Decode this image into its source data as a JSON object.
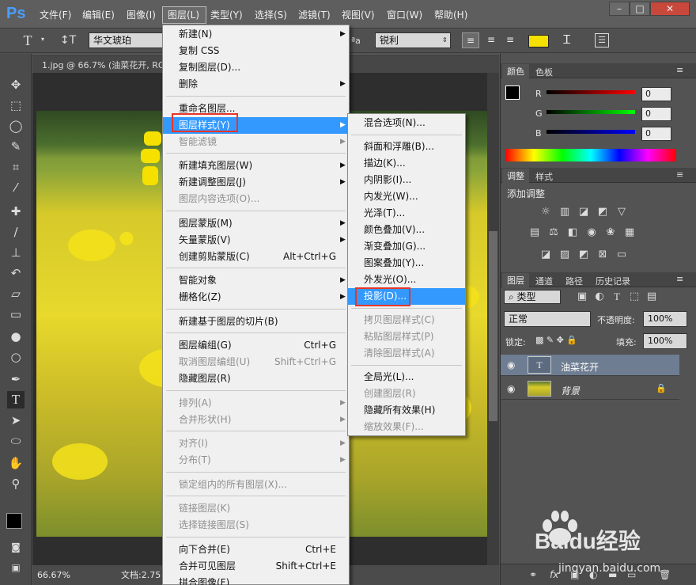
{
  "app": {
    "logo": "Ps",
    "document_tab": "1.jpg @ 66.7% (油菜花开, RGB",
    "zoom": "66.67%",
    "status": "文档:2.75"
  },
  "menubar": {
    "items": [
      "文件(F)",
      "编辑(E)",
      "图像(I)",
      "图层(L)",
      "类型(Y)",
      "选择(S)",
      "滤镜(T)",
      "视图(V)",
      "窗口(W)",
      "帮助(H)"
    ]
  },
  "options": {
    "font": "华文琥珀",
    "antialias": "锐利",
    "color": "#f5e000"
  },
  "layer_menu": {
    "items": [
      {
        "label": "新建(N)",
        "arrow": true
      },
      {
        "label": "复制 CSS"
      },
      {
        "label": "复制图层(D)..."
      },
      {
        "label": "删除",
        "arrow": true
      },
      {
        "sep": true
      },
      {
        "label": "重命名图层..."
      },
      {
        "label": "图层样式(Y)",
        "arrow": true,
        "highlight": true
      },
      {
        "label": "智能滤镜",
        "arrow": true,
        "disabled": true
      },
      {
        "sep": true
      },
      {
        "label": "新建填充图层(W)",
        "arrow": true
      },
      {
        "label": "新建调整图层(J)",
        "arrow": true
      },
      {
        "label": "图层内容选项(O)...",
        "disabled": true
      },
      {
        "sep": true
      },
      {
        "label": "图层蒙版(M)",
        "arrow": true
      },
      {
        "label": "矢量蒙版(V)",
        "arrow": true
      },
      {
        "label": "创建剪贴蒙版(C)",
        "shortcut": "Alt+Ctrl+G"
      },
      {
        "sep": true
      },
      {
        "label": "智能对象",
        "arrow": true
      },
      {
        "label": "栅格化(Z)",
        "arrow": true
      },
      {
        "sep": true
      },
      {
        "label": "新建基于图层的切片(B)"
      },
      {
        "sep": true
      },
      {
        "label": "图层编组(G)",
        "shortcut": "Ctrl+G"
      },
      {
        "label": "取消图层编组(U)",
        "shortcut": "Shift+Ctrl+G",
        "disabled": true
      },
      {
        "label": "隐藏图层(R)"
      },
      {
        "sep": true
      },
      {
        "label": "排列(A)",
        "arrow": true,
        "disabled": true
      },
      {
        "label": "合并形状(H)",
        "arrow": true,
        "disabled": true
      },
      {
        "sep": true
      },
      {
        "label": "对齐(I)",
        "arrow": true,
        "disabled": true
      },
      {
        "label": "分布(T)",
        "arrow": true,
        "disabled": true
      },
      {
        "sep": true
      },
      {
        "label": "锁定组内的所有图层(X)...",
        "disabled": true
      },
      {
        "sep": true
      },
      {
        "label": "链接图层(K)",
        "disabled": true
      },
      {
        "label": "选择链接图层(S)",
        "disabled": true
      },
      {
        "sep": true
      },
      {
        "label": "向下合并(E)",
        "shortcut": "Ctrl+E"
      },
      {
        "label": "合并可见图层",
        "shortcut": "Shift+Ctrl+E"
      },
      {
        "label": "拼合图像(F)"
      }
    ]
  },
  "style_menu": {
    "items": [
      {
        "label": "混合选项(N)..."
      },
      {
        "sep": true
      },
      {
        "label": "斜面和浮雕(B)..."
      },
      {
        "label": "描边(K)..."
      },
      {
        "label": "内阴影(I)..."
      },
      {
        "label": "内发光(W)..."
      },
      {
        "label": "光泽(T)..."
      },
      {
        "label": "颜色叠加(V)..."
      },
      {
        "label": "渐变叠加(G)..."
      },
      {
        "label": "图案叠加(Y)..."
      },
      {
        "label": "外发光(O)..."
      },
      {
        "label": "投影(D)...",
        "highlight": true
      },
      {
        "sep": true
      },
      {
        "label": "拷贝图层样式(C)",
        "disabled": true
      },
      {
        "label": "粘贴图层样式(P)",
        "disabled": true
      },
      {
        "label": "清除图层样式(A)",
        "disabled": true
      },
      {
        "sep": true
      },
      {
        "label": "全局光(L)..."
      },
      {
        "label": "创建图层(R)",
        "disabled": true
      },
      {
        "label": "隐藏所有效果(H)"
      },
      {
        "label": "缩放效果(F)...",
        "disabled": true
      }
    ]
  },
  "color_panel": {
    "tabs": [
      "颜色",
      "色板"
    ],
    "r_label": "R",
    "g_label": "G",
    "b_label": "B",
    "r": "0",
    "g": "0",
    "b": "0"
  },
  "adjust_panel": {
    "tabs": [
      "调整",
      "样式"
    ],
    "title": "添加调整"
  },
  "layers_panel": {
    "tabs": [
      "图层",
      "通道",
      "路径",
      "历史记录"
    ],
    "filter": "类型",
    "blend_mode": "正常",
    "opacity_label": "不透明度:",
    "opacity": "100%",
    "lock_label": "锁定:",
    "fill_label": "填充:",
    "fill": "100%",
    "layers": [
      {
        "name": "油菜花开",
        "type": "T",
        "selected": true
      },
      {
        "name": "背景",
        "locked": true
      }
    ]
  },
  "watermark": {
    "brand": "Baidu经验",
    "url": "jingyan.baidu.com"
  }
}
